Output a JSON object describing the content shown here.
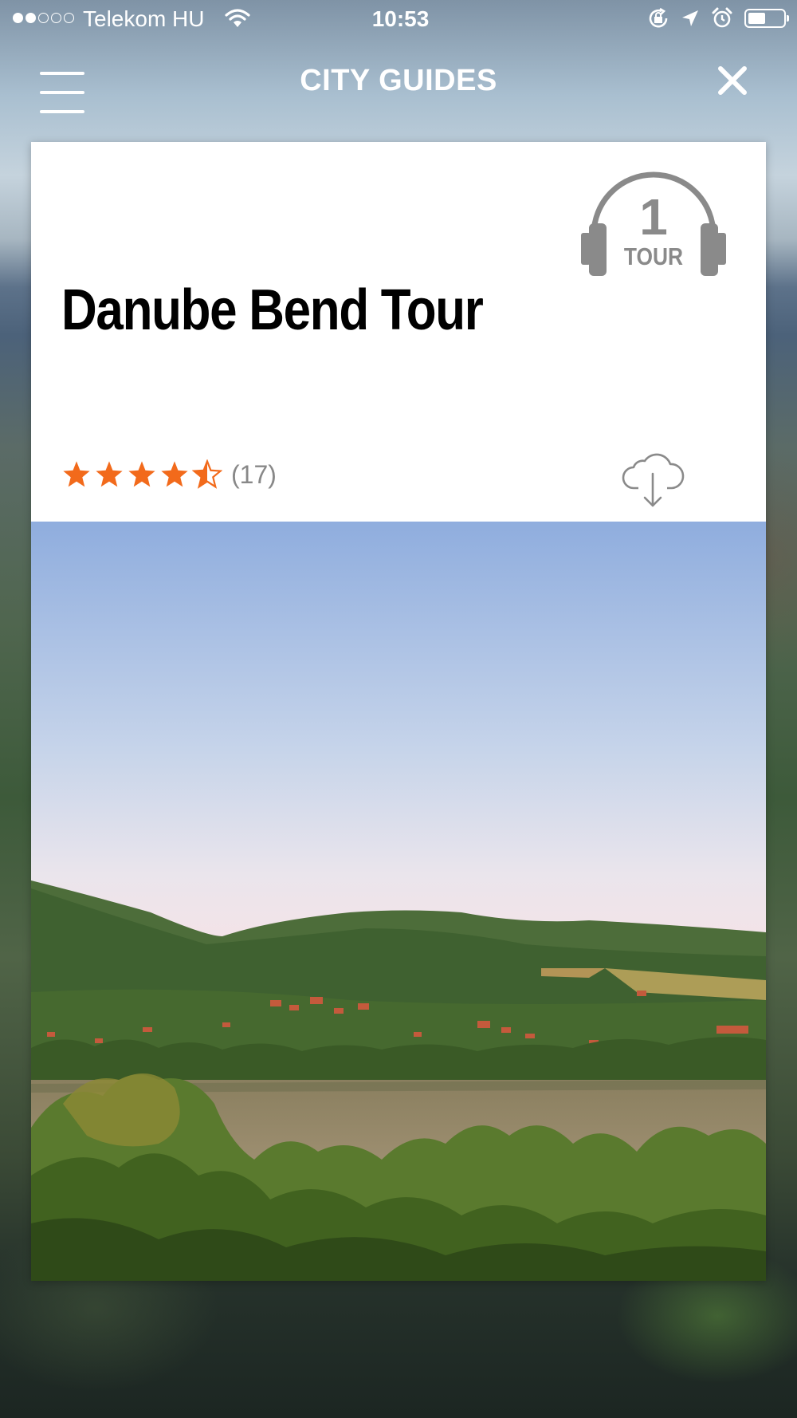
{
  "status_bar": {
    "carrier": "Telekom HU",
    "time": "10:53",
    "signal_bars_filled": 2,
    "signal_bars_total": 5,
    "battery_level": 0.5
  },
  "nav": {
    "title": "CITY GUIDES"
  },
  "card": {
    "title": "Danube Bend Tour",
    "badge_number": "1",
    "badge_label": "TOUR",
    "rating": 4.5,
    "rating_count": "(17)"
  },
  "colors": {
    "star": "#f26a1b",
    "icon_gray": "#8a8a8a"
  },
  "icons": {
    "menu": "hamburger-menu-icon",
    "close": "close-icon",
    "badge": "headphones-icon",
    "download": "cloud-download-icon"
  }
}
